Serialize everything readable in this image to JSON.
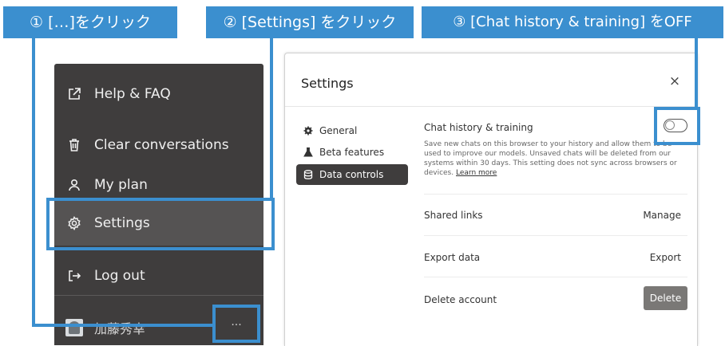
{
  "steps": [
    {
      "label": "① […]をクリック"
    },
    {
      "label": "② [Settings] をクリック"
    },
    {
      "label": "③ [Chat history & training] をOFF"
    }
  ],
  "menu": {
    "items": [
      {
        "label": "Help & FAQ",
        "icon": "external-link-icon"
      },
      {
        "label": "Clear conversations",
        "icon": "trash-icon"
      },
      {
        "label": "My plan",
        "icon": "user-icon"
      },
      {
        "label": "Settings",
        "icon": "gear-icon"
      },
      {
        "label": "Log out",
        "icon": "logout-icon"
      }
    ],
    "user_name": "加藤秀幸",
    "more_label": "···"
  },
  "settings": {
    "title": "Settings",
    "close_label": "×",
    "nav": [
      {
        "label": "General",
        "icon": "gear-icon"
      },
      {
        "label": "Beta features",
        "icon": "flask-icon"
      },
      {
        "label": "Data controls",
        "icon": "database-icon"
      }
    ],
    "chat_history": {
      "label": "Chat history & training",
      "description": "Save new chats on this browser to your history and allow them to be used to improve our models. Unsaved chats will be deleted from our systems within 30 days. This setting does not sync across browsers or devices.",
      "learn_more": "Learn more",
      "enabled": false
    },
    "rows": [
      {
        "label": "Shared links",
        "action": "Manage"
      },
      {
        "label": "Export data",
        "action": "Export"
      },
      {
        "label": "Delete account",
        "action": "Delete"
      }
    ]
  },
  "colors": {
    "accent": "#3b8fcf",
    "menu_bg": "#3f3d3d",
    "delete_button": "#7a7876"
  }
}
